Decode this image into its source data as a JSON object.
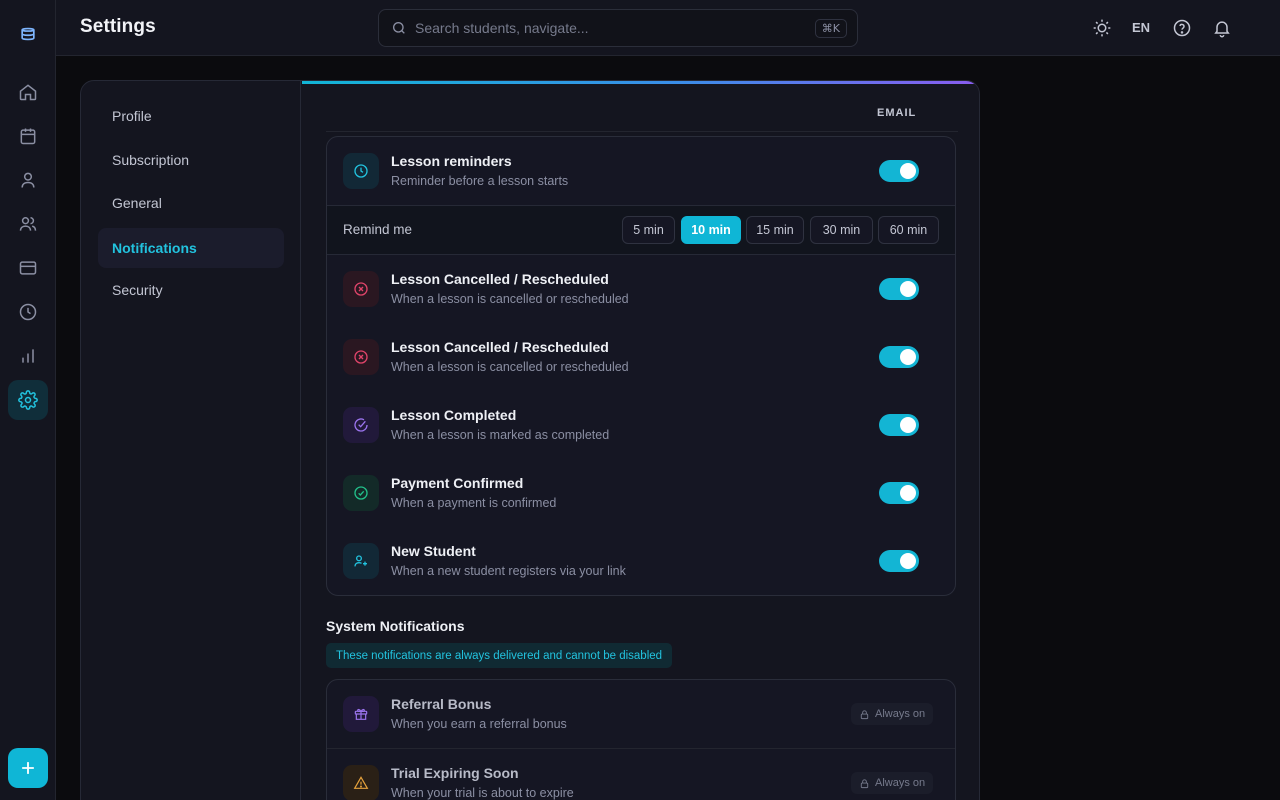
{
  "topbar": {
    "title": "Settings",
    "search_placeholder": "Search students, navigate...",
    "search_shortcut": "⌘K",
    "language": "EN"
  },
  "rail": {
    "icons": [
      "logo-icon",
      "home-icon",
      "calendar-icon",
      "user-icon",
      "users-icon",
      "credit-card-icon",
      "clock-icon",
      "chart-icon",
      "gear-icon"
    ],
    "active": "gear-icon",
    "add_icon": "plus-icon"
  },
  "settings_nav": {
    "items": [
      "Profile",
      "Subscription",
      "General",
      "Notifications",
      "Security"
    ],
    "active": "Notifications"
  },
  "notifications": {
    "column_header": "EMAIL",
    "lesson_reminders": {
      "title": "Lesson reminders",
      "subtitle": "Reminder before a lesson starts",
      "enabled": true,
      "remind_label": "Remind me",
      "options": [
        "5 min",
        "10 min",
        "15 min",
        "30 min",
        "60 min"
      ],
      "selected": "10 min"
    },
    "items": [
      {
        "title": "Lesson Cancelled / Rescheduled",
        "subtitle": "When a lesson is cancelled or rescheduled",
        "icon": "x-circle-icon",
        "enabled": true
      },
      {
        "title": "Lesson Cancelled / Rescheduled",
        "subtitle": "When a lesson is cancelled or rescheduled",
        "icon": "x-circle-icon",
        "enabled": true
      },
      {
        "title": "Lesson Completed",
        "subtitle": "When a lesson is marked as completed",
        "icon": "check-circle-icon",
        "enabled": true
      },
      {
        "title": "Payment Confirmed",
        "subtitle": "When a payment is confirmed",
        "icon": "check-circle-icon",
        "enabled": true
      },
      {
        "title": "New Student",
        "subtitle": "When a new student registers via your link",
        "icon": "user-plus-icon",
        "enabled": true
      }
    ]
  },
  "system": {
    "title": "System Notifications",
    "note": "These notifications are always delivered and cannot be disabled",
    "items": [
      {
        "title": "Referral Bonus",
        "subtitle": "When you earn a referral bonus",
        "badge": "Always on",
        "icon": "gift-icon"
      },
      {
        "title": "Trial Expiring Soon",
        "subtitle": "When your trial is about to expire",
        "badge": "Always on",
        "icon": "warning-icon"
      }
    ]
  },
  "colors": {
    "accent": "#13b5d4",
    "background": "#0b0b0e",
    "panel": "#14151f"
  }
}
